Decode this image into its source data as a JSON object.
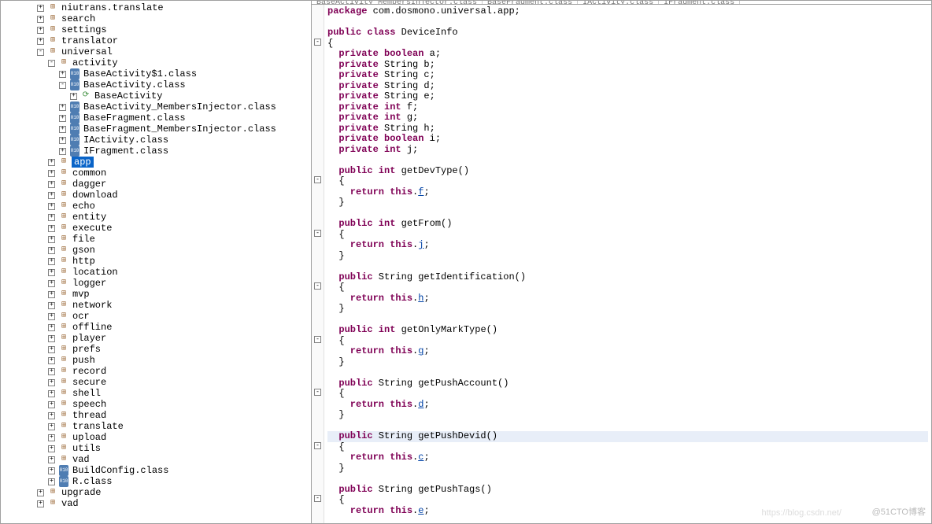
{
  "tree": [
    {
      "depth": 3,
      "exp": "+",
      "icon": "pkg",
      "label": "niutrans.translate"
    },
    {
      "depth": 3,
      "exp": "+",
      "icon": "pkg",
      "label": "search"
    },
    {
      "depth": 3,
      "exp": "+",
      "icon": "pkg",
      "label": "settings"
    },
    {
      "depth": 3,
      "exp": "+",
      "icon": "pkg",
      "label": "translator"
    },
    {
      "depth": 3,
      "exp": "-",
      "icon": "pkg",
      "label": "universal"
    },
    {
      "depth": 4,
      "exp": "-",
      "icon": "pkg",
      "label": "activity"
    },
    {
      "depth": 5,
      "exp": "+",
      "icon": "class",
      "label": "BaseActivity$1.class"
    },
    {
      "depth": 5,
      "exp": "-",
      "icon": "class",
      "label": "BaseActivity.class"
    },
    {
      "depth": 6,
      "exp": "+",
      "icon": "run",
      "label": "BaseActivity"
    },
    {
      "depth": 5,
      "exp": "+",
      "icon": "class",
      "label": "BaseActivity_MembersInjector.class"
    },
    {
      "depth": 5,
      "exp": "+",
      "icon": "class",
      "label": "BaseFragment.class"
    },
    {
      "depth": 5,
      "exp": "+",
      "icon": "class",
      "label": "BaseFragment_MembersInjector.class"
    },
    {
      "depth": 5,
      "exp": "+",
      "icon": "class",
      "label": "IActivity.class"
    },
    {
      "depth": 5,
      "exp": "+",
      "icon": "class",
      "label": "IFragment.class"
    },
    {
      "depth": 4,
      "exp": "+",
      "icon": "pkg",
      "label": "app",
      "selected": true
    },
    {
      "depth": 4,
      "exp": "+",
      "icon": "pkg",
      "label": "common"
    },
    {
      "depth": 4,
      "exp": "+",
      "icon": "pkg",
      "label": "dagger"
    },
    {
      "depth": 4,
      "exp": "+",
      "icon": "pkg",
      "label": "download"
    },
    {
      "depth": 4,
      "exp": "+",
      "icon": "pkg",
      "label": "echo"
    },
    {
      "depth": 4,
      "exp": "+",
      "icon": "pkg",
      "label": "entity"
    },
    {
      "depth": 4,
      "exp": "+",
      "icon": "pkg",
      "label": "execute"
    },
    {
      "depth": 4,
      "exp": "+",
      "icon": "pkg",
      "label": "file"
    },
    {
      "depth": 4,
      "exp": "+",
      "icon": "pkg",
      "label": "gson"
    },
    {
      "depth": 4,
      "exp": "+",
      "icon": "pkg",
      "label": "http"
    },
    {
      "depth": 4,
      "exp": "+",
      "icon": "pkg",
      "label": "location"
    },
    {
      "depth": 4,
      "exp": "+",
      "icon": "pkg",
      "label": "logger"
    },
    {
      "depth": 4,
      "exp": "+",
      "icon": "pkg",
      "label": "mvp"
    },
    {
      "depth": 4,
      "exp": "+",
      "icon": "pkg",
      "label": "network"
    },
    {
      "depth": 4,
      "exp": "+",
      "icon": "pkg",
      "label": "ocr"
    },
    {
      "depth": 4,
      "exp": "+",
      "icon": "pkg",
      "label": "offline"
    },
    {
      "depth": 4,
      "exp": "+",
      "icon": "pkg",
      "label": "player"
    },
    {
      "depth": 4,
      "exp": "+",
      "icon": "pkg",
      "label": "prefs"
    },
    {
      "depth": 4,
      "exp": "+",
      "icon": "pkg",
      "label": "push"
    },
    {
      "depth": 4,
      "exp": "+",
      "icon": "pkg",
      "label": "record"
    },
    {
      "depth": 4,
      "exp": "+",
      "icon": "pkg",
      "label": "secure"
    },
    {
      "depth": 4,
      "exp": "+",
      "icon": "pkg",
      "label": "shell"
    },
    {
      "depth": 4,
      "exp": "+",
      "icon": "pkg",
      "label": "speech"
    },
    {
      "depth": 4,
      "exp": "+",
      "icon": "pkg",
      "label": "thread"
    },
    {
      "depth": 4,
      "exp": "+",
      "icon": "pkg",
      "label": "translate"
    },
    {
      "depth": 4,
      "exp": "+",
      "icon": "pkg",
      "label": "upload"
    },
    {
      "depth": 4,
      "exp": "+",
      "icon": "pkg",
      "label": "utils"
    },
    {
      "depth": 4,
      "exp": "+",
      "icon": "pkg",
      "label": "vad"
    },
    {
      "depth": 4,
      "exp": "+",
      "icon": "class",
      "label": "BuildConfig.class"
    },
    {
      "depth": 4,
      "exp": "+",
      "icon": "class",
      "label": "R.class"
    },
    {
      "depth": 3,
      "exp": "+",
      "icon": "pkg",
      "label": "upgrade"
    },
    {
      "depth": 3,
      "exp": "+",
      "icon": "pkg",
      "label": "vad"
    }
  ],
  "tabs": [
    {
      "label": "BaseActivity_MembersInjector.class"
    },
    {
      "label": "BaseFragment.class"
    },
    {
      "label": "IActivity.class"
    },
    {
      "label": "IFragment.class"
    }
  ],
  "code": [
    {
      "t": "package",
      "c": [
        [
          "kw",
          "package"
        ],
        [
          "pkg",
          " com.dosmono.universal.app;"
        ]
      ]
    },
    {
      "t": "blank"
    },
    {
      "t": "pub",
      "c": [
        [
          "kw",
          "public class"
        ],
        [
          "pkg",
          " DeviceInfo"
        ]
      ]
    },
    {
      "t": "brace",
      "fold": "-",
      "c": "{"
    },
    {
      "t": "field",
      "c": [
        [
          "kw",
          "  private boolean"
        ],
        [
          "pkg",
          " a;"
        ]
      ]
    },
    {
      "t": "field",
      "c": [
        [
          "kw",
          "  private"
        ],
        [
          "pkg",
          " String b;"
        ]
      ]
    },
    {
      "t": "field",
      "c": [
        [
          "kw",
          "  private"
        ],
        [
          "pkg",
          " String c;"
        ]
      ]
    },
    {
      "t": "field",
      "c": [
        [
          "kw",
          "  private"
        ],
        [
          "pkg",
          " String d;"
        ]
      ]
    },
    {
      "t": "field",
      "c": [
        [
          "kw",
          "  private"
        ],
        [
          "pkg",
          " String e;"
        ]
      ]
    },
    {
      "t": "field",
      "c": [
        [
          "kw",
          "  private int"
        ],
        [
          "pkg",
          " f;"
        ]
      ]
    },
    {
      "t": "field",
      "c": [
        [
          "kw",
          "  private int"
        ],
        [
          "pkg",
          " g;"
        ]
      ]
    },
    {
      "t": "field",
      "c": [
        [
          "kw",
          "  private"
        ],
        [
          "pkg",
          " String h;"
        ]
      ]
    },
    {
      "t": "field",
      "c": [
        [
          "kw",
          "  private boolean"
        ],
        [
          "pkg",
          " i;"
        ]
      ]
    },
    {
      "t": "field",
      "c": [
        [
          "kw",
          "  private int"
        ],
        [
          "pkg",
          " j;"
        ]
      ]
    },
    {
      "t": "blank"
    },
    {
      "t": "method",
      "c": [
        [
          "kw",
          "  public int"
        ],
        [
          "pkg",
          " getDevType()"
        ]
      ]
    },
    {
      "t": "brace",
      "fold": "-",
      "c": "  {"
    },
    {
      "t": "ret",
      "c": [
        [
          "kw",
          "    return this"
        ],
        [
          "pkg",
          "."
        ],
        [
          "linkfld",
          "f"
        ],
        [
          "pkg",
          ";"
        ]
      ]
    },
    {
      "t": "brace",
      "c": "  }"
    },
    {
      "t": "blank"
    },
    {
      "t": "method",
      "c": [
        [
          "kw",
          "  public int"
        ],
        [
          "pkg",
          " getFrom()"
        ]
      ]
    },
    {
      "t": "brace",
      "fold": "-",
      "c": "  {"
    },
    {
      "t": "ret",
      "c": [
        [
          "kw",
          "    return this"
        ],
        [
          "pkg",
          "."
        ],
        [
          "linkfld",
          "j"
        ],
        [
          "pkg",
          ";"
        ]
      ]
    },
    {
      "t": "brace",
      "c": "  }"
    },
    {
      "t": "blank"
    },
    {
      "t": "method",
      "c": [
        [
          "kw",
          "  public"
        ],
        [
          "pkg",
          " String getIdentification()"
        ]
      ]
    },
    {
      "t": "brace",
      "fold": "-",
      "c": "  {"
    },
    {
      "t": "ret",
      "c": [
        [
          "kw",
          "    return this"
        ],
        [
          "pkg",
          "."
        ],
        [
          "linkfld",
          "h"
        ],
        [
          "pkg",
          ";"
        ]
      ]
    },
    {
      "t": "brace",
      "c": "  }"
    },
    {
      "t": "blank"
    },
    {
      "t": "method",
      "c": [
        [
          "kw",
          "  public int"
        ],
        [
          "pkg",
          " getOnlyMarkType()"
        ]
      ]
    },
    {
      "t": "brace",
      "fold": "-",
      "c": "  {"
    },
    {
      "t": "ret",
      "c": [
        [
          "kw",
          "    return this"
        ],
        [
          "pkg",
          "."
        ],
        [
          "linkfld",
          "g"
        ],
        [
          "pkg",
          ";"
        ]
      ]
    },
    {
      "t": "brace",
      "c": "  }"
    },
    {
      "t": "blank"
    },
    {
      "t": "method",
      "c": [
        [
          "kw",
          "  public"
        ],
        [
          "pkg",
          " String getPushAccount()"
        ]
      ]
    },
    {
      "t": "brace",
      "fold": "-",
      "c": "  {"
    },
    {
      "t": "ret",
      "c": [
        [
          "kw",
          "    return this"
        ],
        [
          "pkg",
          "."
        ],
        [
          "linkfld",
          "d"
        ],
        [
          "pkg",
          ";"
        ]
      ]
    },
    {
      "t": "brace",
      "c": "  }"
    },
    {
      "t": "blank"
    },
    {
      "t": "method",
      "hl": true,
      "c": [
        [
          "kw",
          "  public"
        ],
        [
          "pkg",
          " String getPushDevid()"
        ]
      ]
    },
    {
      "t": "brace",
      "fold": "-",
      "c": "  {"
    },
    {
      "t": "ret",
      "c": [
        [
          "kw",
          "    return this"
        ],
        [
          "pkg",
          "."
        ],
        [
          "linkfld",
          "c"
        ],
        [
          "pkg",
          ";"
        ]
      ]
    },
    {
      "t": "brace",
      "c": "  }"
    },
    {
      "t": "blank"
    },
    {
      "t": "method",
      "c": [
        [
          "kw",
          "  public"
        ],
        [
          "pkg",
          " String getPushTags()"
        ]
      ]
    },
    {
      "t": "brace",
      "fold": "-",
      "c": "  {"
    },
    {
      "t": "ret",
      "c": [
        [
          "kw",
          "    return this"
        ],
        [
          "pkg",
          "."
        ],
        [
          "linkfld",
          "e"
        ],
        [
          "pkg",
          ";"
        ]
      ]
    }
  ],
  "watermark": "@51CTO博客",
  "watermark2": "https://blog.csdn.net/"
}
